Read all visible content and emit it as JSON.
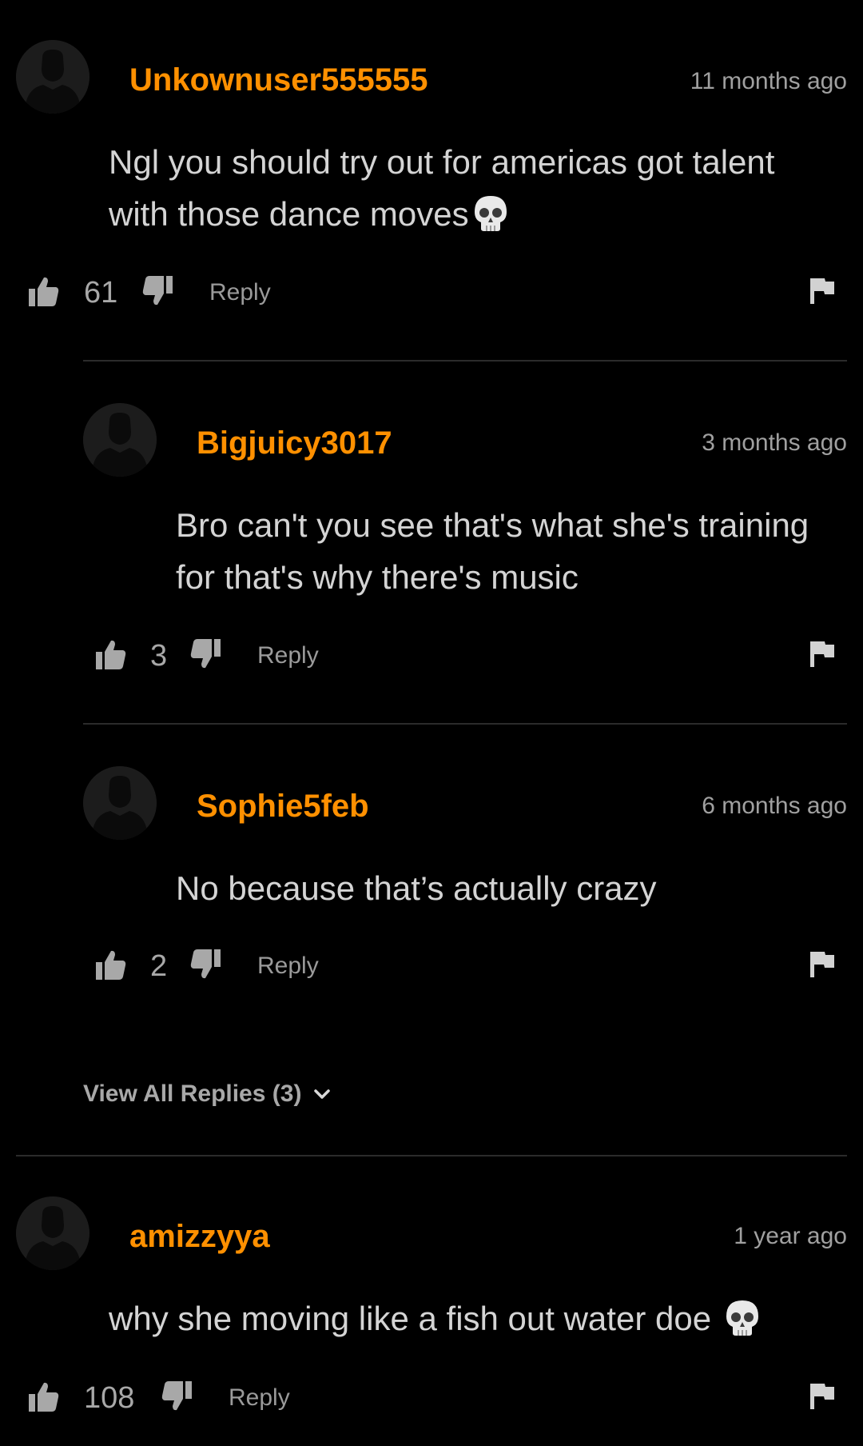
{
  "comments": [
    {
      "username": "Unkownuser555555",
      "time": "11 months ago",
      "text": "Ngl you should try out for americas got talent with those dance moves",
      "emoji": "skull",
      "likes": "61",
      "reply_label": "Reply"
    },
    {
      "username": "Bigjuicy3017",
      "time": "3 months ago",
      "text": "Bro can't you see that's what she's training for that's why there's music",
      "likes": "3",
      "reply_label": "Reply"
    },
    {
      "username": "Sophie5feb",
      "time": "6 months ago",
      "text": "No because that’s actually crazy",
      "likes": "2",
      "reply_label": "Reply"
    },
    {
      "username": "amizzyya",
      "time": "1 year ago",
      "text": "why she moving like a fish out water doe ",
      "emoji": "skull",
      "likes": "108",
      "reply_label": "Reply"
    }
  ],
  "view_all_replies": "View All Replies (3)",
  "colors": {
    "background": "#000000",
    "username": "#ff9000",
    "body_text": "#d4d4d4",
    "meta_text": "#a0a0a0"
  },
  "icons": [
    "avatar-placeholder-icon",
    "thumbs-up-icon",
    "thumbs-down-icon",
    "flag-icon",
    "chevron-down-icon",
    "skull-emoji"
  ]
}
